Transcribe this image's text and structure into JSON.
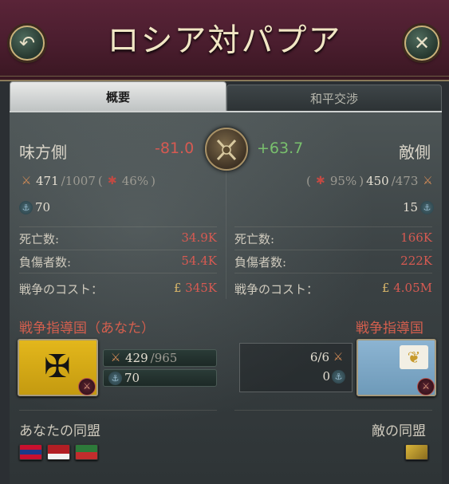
{
  "header": {
    "title": "ロシア対パプア",
    "back_icon": "↶",
    "close_icon": "✕"
  },
  "tabs": [
    {
      "label": "概要",
      "active": true
    },
    {
      "label": "和平交渉",
      "active": false
    }
  ],
  "summary": {
    "ally_label": "味方側",
    "enemy_label": "敵側",
    "ally_score": "-81.0",
    "enemy_score": "+63.7",
    "ally_army": {
      "current": "471",
      "max": "/1007",
      "losses_pct": "46%"
    },
    "enemy_army": {
      "current": "450",
      "max": "/473",
      "losses_pct": "95%"
    },
    "ally_navy": "70",
    "enemy_navy": "15",
    "ally_stats": [
      {
        "label": "死亡数:",
        "value": "34.9K"
      },
      {
        "label": "負傷者数:",
        "value": "54.4K"
      },
      {
        "label": "戦争のコスト：",
        "value": "345K",
        "prefix": "£"
      }
    ],
    "enemy_stats": [
      {
        "label": "死亡数:",
        "value": "166K"
      },
      {
        "label": "負傷者数:",
        "value": "222K"
      },
      {
        "label": "戦争のコスト：",
        "value": "4.05M",
        "prefix": "£"
      }
    ]
  },
  "leaders": {
    "ally_title": "戦争指導国（あなた）",
    "enemy_title": "戦争指導国",
    "ally_army": {
      "current": "429",
      "max": "/965"
    },
    "ally_navy": "70",
    "enemy_army": "6/6",
    "enemy_navy": "0"
  },
  "alliances": {
    "ally_title": "あなたの同盟",
    "enemy_title": "敵の同盟"
  },
  "colors": {
    "negative": "#d65a52",
    "positive": "#79c06d",
    "accent_gold": "#c9b27a"
  }
}
